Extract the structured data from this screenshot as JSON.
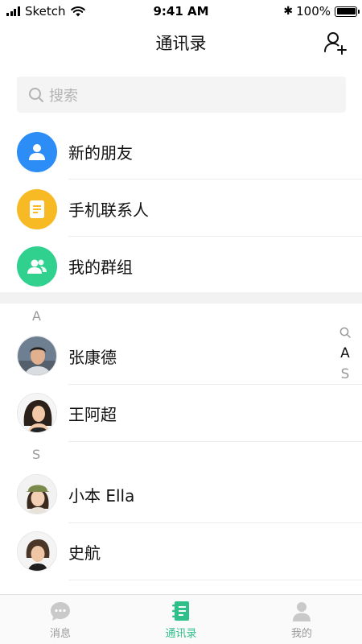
{
  "status_bar": {
    "carrier": "Sketch",
    "time": "9:41 AM",
    "battery": "100%",
    "bluetooth_glyph": "✱"
  },
  "header": {
    "title": "通讯录"
  },
  "search": {
    "placeholder": "搜索"
  },
  "functions": [
    {
      "label": "新的朋友",
      "icon": "person-icon",
      "color": "#2d8df6"
    },
    {
      "label": "手机联系人",
      "icon": "document-icon",
      "color": "#f7b924"
    },
    {
      "label": "我的群组",
      "icon": "group-icon",
      "color": "#30d08f"
    }
  ],
  "contacts": {
    "group_a": {
      "letter": "A",
      "items": [
        {
          "name": "张康德"
        },
        {
          "name": "王阿超"
        }
      ]
    },
    "group_s": {
      "letter": "S",
      "items": [
        {
          "name": "小本 Ella"
        },
        {
          "name": "史航"
        }
      ]
    }
  },
  "index_bar": {
    "items": [
      "A",
      "S"
    ],
    "active": "A",
    "search_icon": "search-icon"
  },
  "tab_bar": {
    "tabs": [
      {
        "label": "消息",
        "icon": "chat-bubble-icon"
      },
      {
        "label": "通讯录",
        "icon": "address-book-icon",
        "active": true
      },
      {
        "label": "我的",
        "icon": "profile-icon"
      }
    ]
  },
  "colors": {
    "accent": "#2fbf8a",
    "muted": "#999999",
    "divider": "#ececec"
  }
}
